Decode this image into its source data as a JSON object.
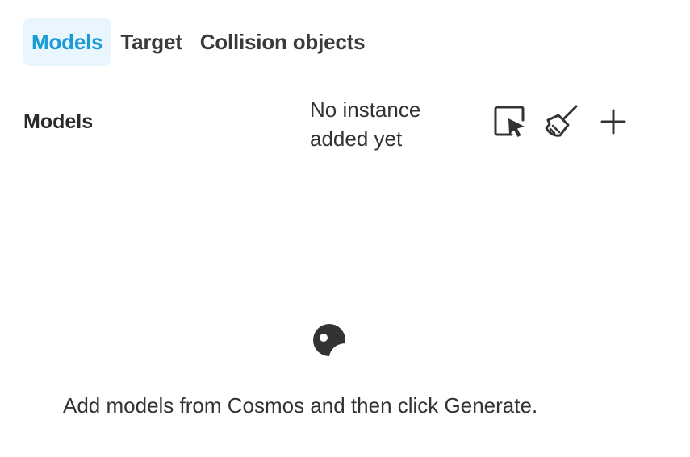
{
  "tabs": [
    {
      "label": "Models",
      "active": true
    },
    {
      "label": "Target",
      "active": false
    },
    {
      "label": "Collision objects",
      "active": false
    }
  ],
  "section": {
    "title": "Models",
    "status": "No instance added yet"
  },
  "toolbar": {
    "icons": [
      "select-cursor-icon",
      "broom-icon",
      "plus-icon"
    ]
  },
  "empty_state": {
    "icon": "cosmos-icon",
    "message": "Add models from Cosmos and then click Generate."
  },
  "colors": {
    "accent": "#1a9bd7",
    "active_tab_bg": "#eaf6fd",
    "text": "#2b2b2b",
    "icon": "#333333"
  }
}
